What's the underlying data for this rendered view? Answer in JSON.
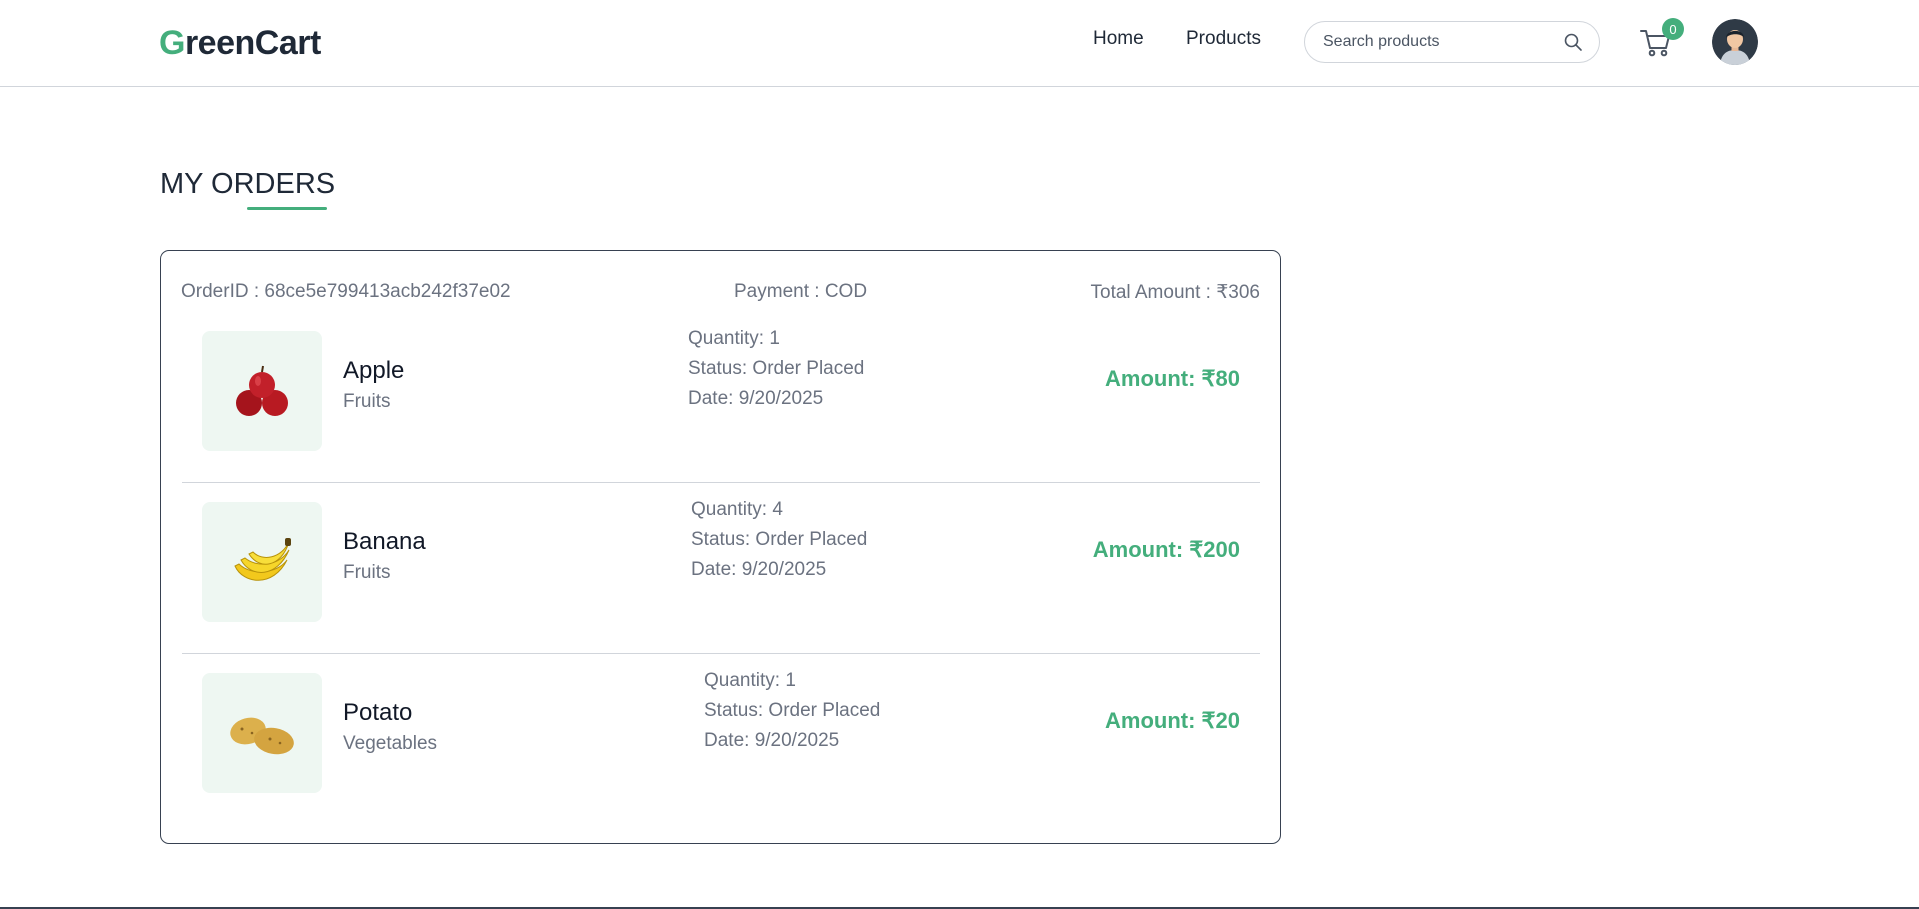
{
  "header": {
    "logo_letter": "G",
    "logo_rest": "reenCart",
    "nav": [
      {
        "label": "Home"
      },
      {
        "label": "Products"
      }
    ],
    "search_placeholder": "Search products",
    "cart_count": "0",
    "accent_color": "#44ae7c"
  },
  "page": {
    "title": "MY ORDERS"
  },
  "order": {
    "id_text": "OrderID : 68ce5e799413acb242f37e02",
    "payment_text": "Payment : COD",
    "total_text": "Total Amount : ₹306",
    "items": [
      {
        "name": "Apple",
        "category": "Fruits",
        "quantity": "Quantity: 1",
        "status": "Status: Order Placed",
        "date": "Date: 9/20/2025",
        "amount": "Amount: ₹80",
        "icon": "apple-icon"
      },
      {
        "name": "Banana",
        "category": "Fruits",
        "quantity": "Quantity: 4",
        "status": "Status: Order Placed",
        "date": "Date: 9/20/2025",
        "amount": "Amount: ₹200",
        "icon": "banana-icon"
      },
      {
        "name": "Potato",
        "category": "Vegetables",
        "quantity": "Quantity: 1",
        "status": "Status: Order Placed",
        "date": "Date: 9/20/2025",
        "amount": "Amount: ₹20",
        "icon": "potato-icon"
      }
    ]
  }
}
